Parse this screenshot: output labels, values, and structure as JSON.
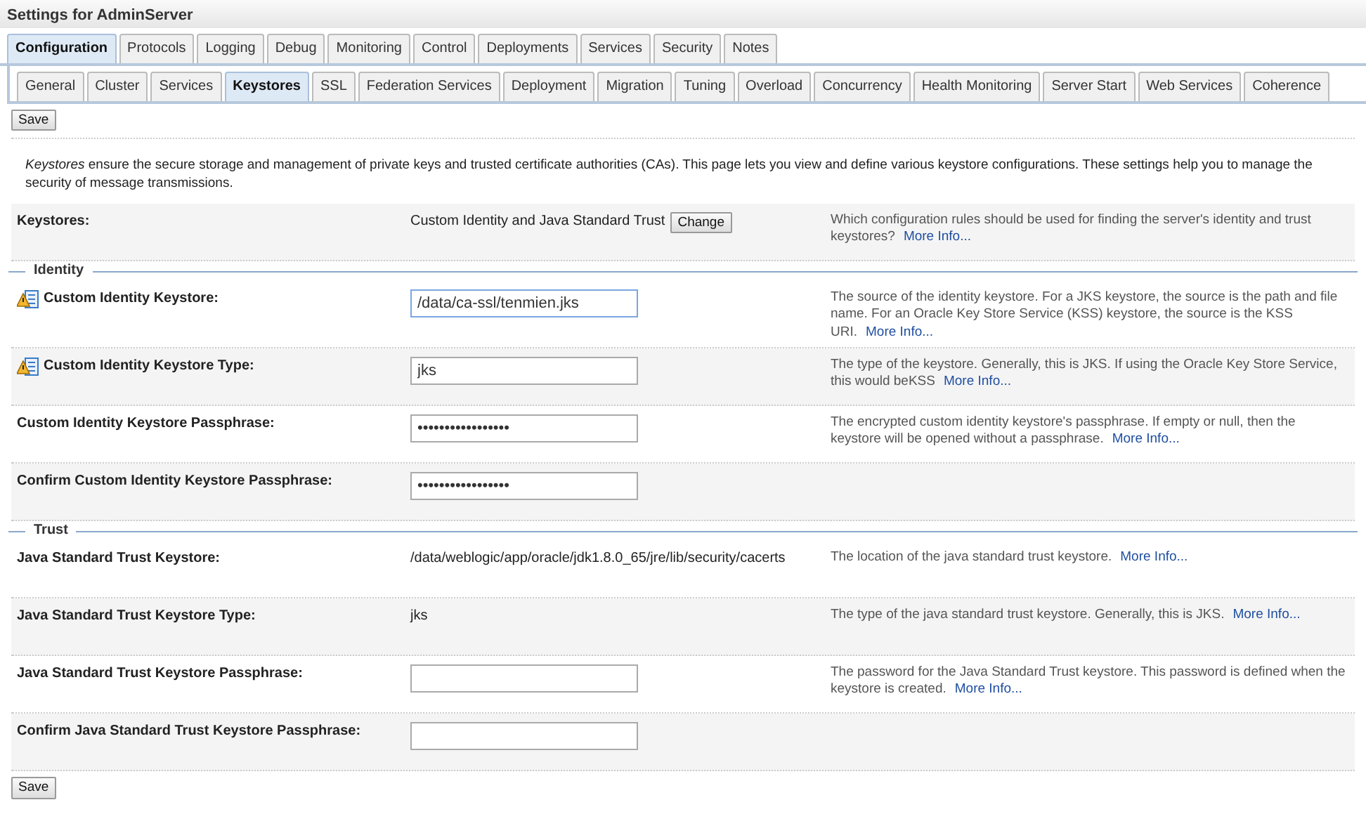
{
  "title": "Settings for AdminServer",
  "tabs": [
    {
      "label": "Configuration",
      "selected": true
    },
    {
      "label": "Protocols",
      "selected": false
    },
    {
      "label": "Logging",
      "selected": false
    },
    {
      "label": "Debug",
      "selected": false
    },
    {
      "label": "Monitoring",
      "selected": false
    },
    {
      "label": "Control",
      "selected": false
    },
    {
      "label": "Deployments",
      "selected": false
    },
    {
      "label": "Services",
      "selected": false
    },
    {
      "label": "Security",
      "selected": false
    },
    {
      "label": "Notes",
      "selected": false
    }
  ],
  "subtabs": [
    {
      "label": "General",
      "selected": false
    },
    {
      "label": "Cluster",
      "selected": false
    },
    {
      "label": "Services",
      "selected": false
    },
    {
      "label": "Keystores",
      "selected": true
    },
    {
      "label": "SSL",
      "selected": false
    },
    {
      "label": "Federation Services",
      "selected": false
    },
    {
      "label": "Deployment",
      "selected": false
    },
    {
      "label": "Migration",
      "selected": false
    },
    {
      "label": "Tuning",
      "selected": false
    },
    {
      "label": "Overload",
      "selected": false
    },
    {
      "label": "Concurrency",
      "selected": false
    },
    {
      "label": "Health Monitoring",
      "selected": false
    },
    {
      "label": "Server Start",
      "selected": false
    },
    {
      "label": "Web Services",
      "selected": false
    },
    {
      "label": "Coherence",
      "selected": false
    }
  ],
  "top_save_button": "Save",
  "intro": "*Keystores* ensure the secure storage and management of private keys and trusted certificate authorities (CAs). This page lets you view and define various keystore configurations. These settings help you to manage the security of message transmissions.",
  "keystores_row": {
    "label": "Keystores:",
    "value": "Custom Identity and Java Standard Trust",
    "button": "Change",
    "help": "Which configuration rules should be used for finding the server's identity and trust keystores?",
    "more_info": "More Info..."
  },
  "sections": [
    {
      "title": "Identity",
      "rows": [
        {
          "kind": "input",
          "label": "Custom Identity Keystore:",
          "warning": true,
          "focused": true,
          "value": "/data/ca-ssl/tenmien.jks",
          "help": "The source of the identity keystore. For a JKS keystore, the source is the path and file name. For an Oracle Key Store Service (KSS) keystore, the source is the KSS URI.",
          "more_info": "More Info..."
        },
        {
          "kind": "input",
          "label": "Custom Identity Keystore Type:",
          "warning": true,
          "focused": false,
          "value": "jks",
          "help": "The type of the keystore. Generally, this is JKS. If using the Oracle Key Store Service, this would beKSS",
          "more_info": "More Info..."
        },
        {
          "kind": "input",
          "label": "Custom Identity Keystore Passphrase:",
          "warning": false,
          "focused": false,
          "value": "•••••••••••••••••",
          "help": "The encrypted custom identity keystore's passphrase. If empty or null, then the keystore will be opened without a passphrase.",
          "more_info": "More Info..."
        },
        {
          "kind": "input",
          "label": "Confirm Custom Identity Keystore Passphrase:",
          "warning": false,
          "focused": false,
          "value": "•••••••••••••••••"
        }
      ]
    },
    {
      "title": "Trust",
      "rows": [
        {
          "kind": "text",
          "label": "Java Standard Trust Keystore:",
          "value": "/data/weblogic/app/oracle/jdk1.8.0_65/jre/lib/security/cacerts",
          "help": "The location of the java standard trust keystore.",
          "more_info": "More Info..."
        },
        {
          "kind": "text",
          "label": "Java Standard Trust Keystore Type:",
          "value": "jks",
          "help": "The type of the java standard trust keystore. Generally, this is JKS.",
          "more_info": "More Info..."
        },
        {
          "kind": "input",
          "label": "Java Standard Trust Keystore Passphrase:",
          "warning": false,
          "focused": false,
          "help": "The password for the Java Standard Trust keystore. This password is defined when the keystore is created.",
          "more_info": "More Info..."
        },
        {
          "kind": "input",
          "label": "Confirm Java Standard Trust Keystore Passphrase:",
          "warning": false,
          "focused": false
        }
      ]
    }
  ],
  "bottom_save_button": "Save"
}
